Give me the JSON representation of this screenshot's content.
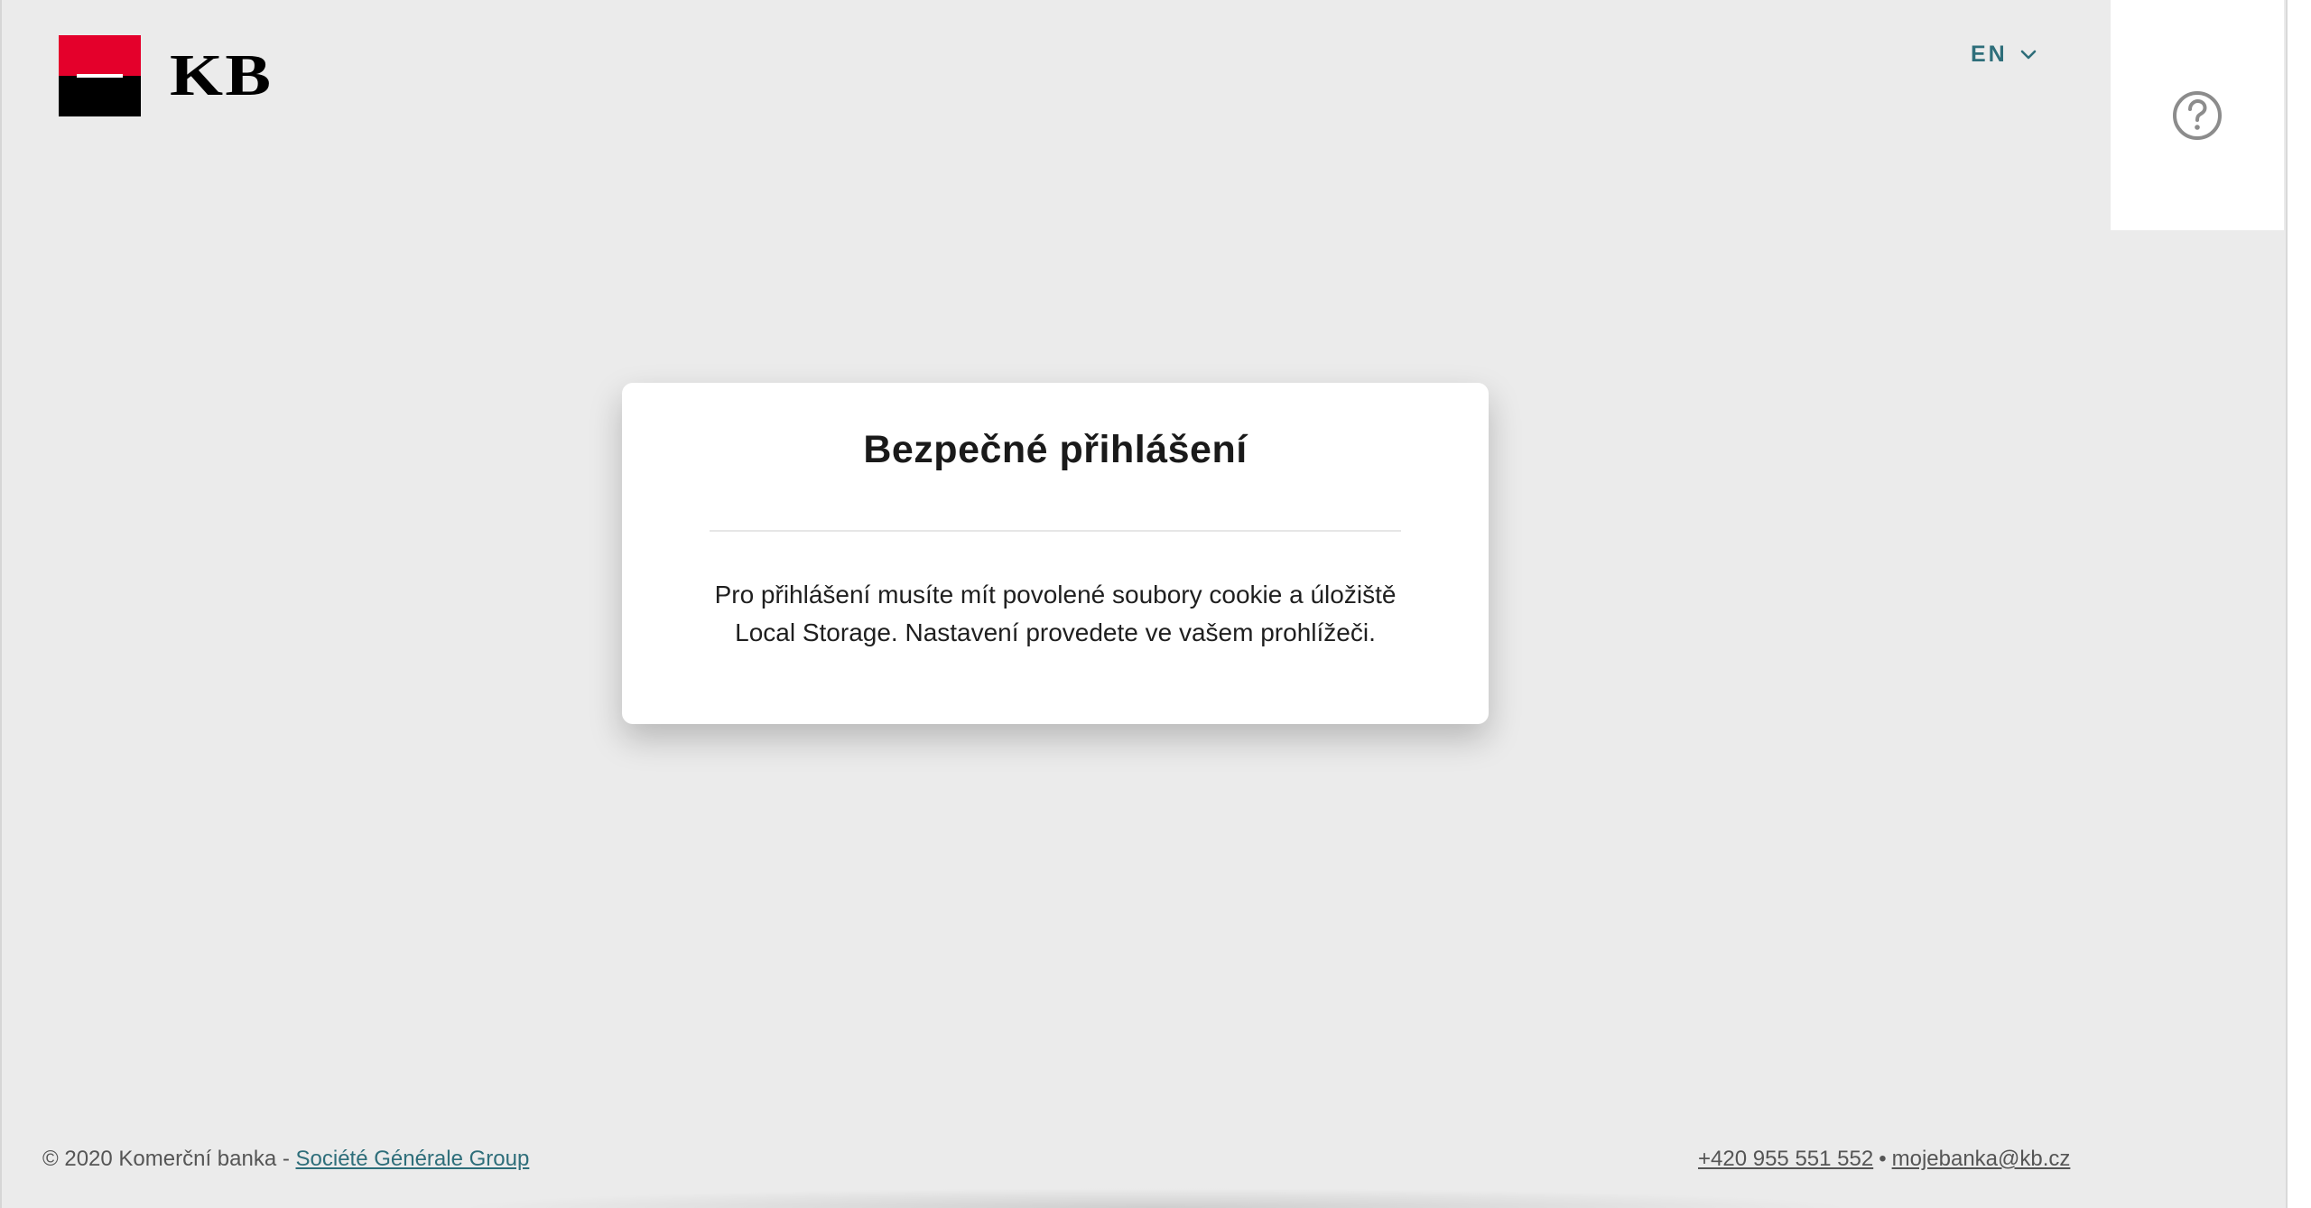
{
  "brand": {
    "logo_text": "KB",
    "colors": {
      "red": "#e4002b",
      "black": "#000000",
      "accent": "#2e6e7a"
    }
  },
  "header": {
    "language": "EN",
    "help_icon": "question-circle-icon",
    "language_icon": "chevron-down-icon"
  },
  "dialog": {
    "title": "Bezpečné přihlášení",
    "message_line1": "Pro přihlášení musíte mít povolené soubory cookie a úložiště",
    "message_line2": "Local Storage. Nastavení provedete ve vašem prohlížeči."
  },
  "footer": {
    "copyright": "© 2020 Komerční banka - ",
    "group_link": "Société Générale Group",
    "phone": "+420 955 551 552",
    "separator": "•",
    "email": "mojebanka@kb.cz"
  }
}
